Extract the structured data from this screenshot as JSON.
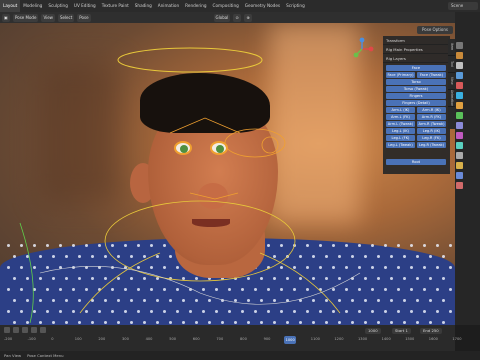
{
  "topbar": {
    "workspaces": [
      "Layout",
      "Modeling",
      "Sculpting",
      "UV Editing",
      "Texture Paint",
      "Shading",
      "Animation",
      "Rendering",
      "Compositing",
      "Geometry Nodes",
      "Scripting"
    ],
    "active_index": 0,
    "scene": "Scene"
  },
  "toolbar": {
    "mode": "Pose Mode",
    "orientation": "Global",
    "pose_options": "Pose Options"
  },
  "npanel": {
    "sections": [
      "Transform",
      "Rig Main Properties",
      "Rig Layers"
    ],
    "layer_buttons": [
      {
        "label": "Face",
        "w": "full"
      },
      {
        "label": "Face (Primary)",
        "w": "half"
      },
      {
        "label": "Face (Tweak)",
        "w": "half"
      },
      {
        "label": "Torso",
        "w": "full"
      },
      {
        "label": "Torso (Tweak)",
        "w": "full"
      },
      {
        "label": "Fingers",
        "w": "full"
      },
      {
        "label": "Fingers (Detail)",
        "w": "full"
      },
      {
        "label": "Arm.L (IK)",
        "w": "half"
      },
      {
        "label": "Arm.R (IK)",
        "w": "half"
      },
      {
        "label": "Arm.L (FK)",
        "w": "half"
      },
      {
        "label": "Arm.R (FK)",
        "w": "half"
      },
      {
        "label": "Arm.L (Tweak)",
        "w": "half"
      },
      {
        "label": "Arm.R (Tweak)",
        "w": "half"
      },
      {
        "label": "Leg.L (IK)",
        "w": "half"
      },
      {
        "label": "Leg.R (IK)",
        "w": "half"
      },
      {
        "label": "Leg.L (FK)",
        "w": "half"
      },
      {
        "label": "Leg.R (FK)",
        "w": "half"
      },
      {
        "label": "Leg.L (Tweak)",
        "w": "half"
      },
      {
        "label": "Leg.R (Tweak)",
        "w": "half"
      },
      {
        "label": "Root",
        "w": "full"
      }
    ],
    "tabs": [
      "Item",
      "Tool",
      "View",
      "Animation"
    ]
  },
  "timeline": {
    "start_label": "Start",
    "start": "1",
    "end_label": "End",
    "end": "250",
    "current": "1000"
  },
  "ruler": [
    "-200",
    "-100",
    "0",
    "100",
    "200",
    "300",
    "400",
    "500",
    "600",
    "700",
    "800",
    "900",
    "1000",
    "1100",
    "1200",
    "1300",
    "1400",
    "1500",
    "1600",
    "1700"
  ],
  "status": {
    "hint": "Pan View",
    "context": "Pose Context Menu"
  },
  "colors": {
    "accent": "#4a72b7",
    "rig_yellow": "#e8c83a",
    "rig_orange": "#f0a030",
    "rig_green": "#5fcf4a"
  }
}
